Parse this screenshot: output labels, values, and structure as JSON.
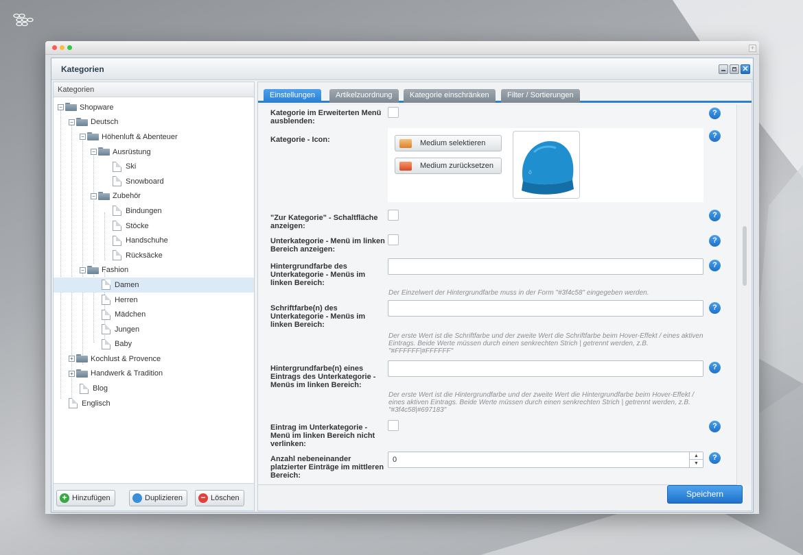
{
  "colors": {
    "accent": "#2a7fd4",
    "selected_row": "#dce9f6",
    "tab_inactive": "#8a949d"
  },
  "window": {
    "title": "Kategorien",
    "controls": [
      "minimize-icon",
      "maximize-icon",
      "close-icon"
    ],
    "close_glyph": "✕",
    "outer_plus_glyph": "+"
  },
  "tree": {
    "header": "Kategorien",
    "nodes": [
      {
        "label": "Shopware",
        "toggle": "−",
        "icon": "folder-open-icon"
      },
      {
        "label": "Deutsch",
        "toggle": "−",
        "icon": "folder-open-icon"
      },
      {
        "label": "Höhenluft & Abenteuer",
        "toggle": "−",
        "icon": "folder-open-icon"
      },
      {
        "label": "Ausrüstung",
        "toggle": "−",
        "icon": "folder-open-icon"
      },
      {
        "label": "Ski",
        "icon": "page-icon"
      },
      {
        "label": "Snowboard",
        "icon": "page-icon"
      },
      {
        "label": "Zubehör",
        "toggle": "−",
        "icon": "folder-open-icon"
      },
      {
        "label": "Bindungen",
        "icon": "page-icon"
      },
      {
        "label": "Stöcke",
        "icon": "page-icon"
      },
      {
        "label": "Handschuhe",
        "icon": "page-icon"
      },
      {
        "label": "Rücksäcke",
        "icon": "page-icon"
      },
      {
        "label": "Fashion",
        "toggle": "−",
        "icon": "folder-open-icon"
      },
      {
        "label": "Damen",
        "icon": "page-icon",
        "selected": true
      },
      {
        "label": "Herren",
        "icon": "page-icon"
      },
      {
        "label": "Mädchen",
        "icon": "page-icon"
      },
      {
        "label": "Jungen",
        "icon": "page-icon"
      },
      {
        "label": "Baby",
        "icon": "page-icon"
      },
      {
        "label": "Kochlust & Provence",
        "toggle": "+",
        "icon": "folder-closed-icon"
      },
      {
        "label": "Handwerk & Tradition",
        "toggle": "+",
        "icon": "folder-closed-icon"
      },
      {
        "label": "Blog",
        "icon": "page-icon"
      },
      {
        "label": "Englisch",
        "icon": "page-icon"
      }
    ],
    "buttons": {
      "add": "Hinzufügen",
      "duplicate": "Duplizieren",
      "delete": "Löschen",
      "add_glyph": "+",
      "delete_glyph": "−"
    }
  },
  "tabs": [
    "Einstellungen",
    "Artikelzuordnung",
    "Kategorie einschränken",
    "Filter / Sortierungen"
  ],
  "form": {
    "help_glyph": "?",
    "hide_in_extended_menu": {
      "label": "Kategorie im Erweiterten Menü ausblenden:",
      "checked": false
    },
    "icon": {
      "label": "Kategorie - Icon:",
      "select_button": "Medium selektieren",
      "reset_button": "Medium zurücksetzen"
    },
    "show_category_button": {
      "label": "\"Zur Kategorie\" - Schaltfläche anzeigen:",
      "checked": false
    },
    "show_sub_menu_left": {
      "label": "Unterkategorie - Menü im linken Bereich anzeigen:",
      "checked": false
    },
    "bg_color": {
      "label": "Hintergrundfarbe des Unterkategorie - Menüs im linken Bereich:",
      "value": "",
      "hint": "Der Einzelwert der Hintergrundfarbe muss in der Form \"#3f4c58\" eingegeben werden."
    },
    "font_color": {
      "label": "Schriftfarbe(n) des Unterkategorie - Menüs im linken Bereich:",
      "value": "",
      "hint": "Der erste Wert ist die Schriftfarbe und der zweite Wert die Schriftfarbe beim Hover-Effekt / eines aktiven Eintrags. Beide Werte müssen durch einen senkrechten Strich | getrennt werden, z.B. \"#FFFFFF|#FFFFFF\""
    },
    "entry_bg_color": {
      "label": "Hintergrundfarbe(n) eines Eintrags des Unterkategorie - Menüs im linken Bereich:",
      "value": "",
      "hint": "Der erste Wert ist die Hintergrundfarbe und der zweite Wert die Hintergrundfarbe beim Hover-Effekt / eines aktiven Eintrags. Beide Werte müssen durch einen senkrechten Strich | getrennt werden, z.B. \"#3f4c58|#697183\""
    },
    "no_link_entry": {
      "label": "Eintrag im Unterkategorie - Menü im linken Bereich nicht verlinken:",
      "checked": false
    },
    "entries_side_by_side": {
      "label": "Anzahl nebeneinander platzierter Einträge im mittleren Bereich:",
      "value": "0",
      "spin_up": "▲",
      "spin_down": "▼"
    }
  },
  "footer": {
    "save": "Speichern"
  }
}
